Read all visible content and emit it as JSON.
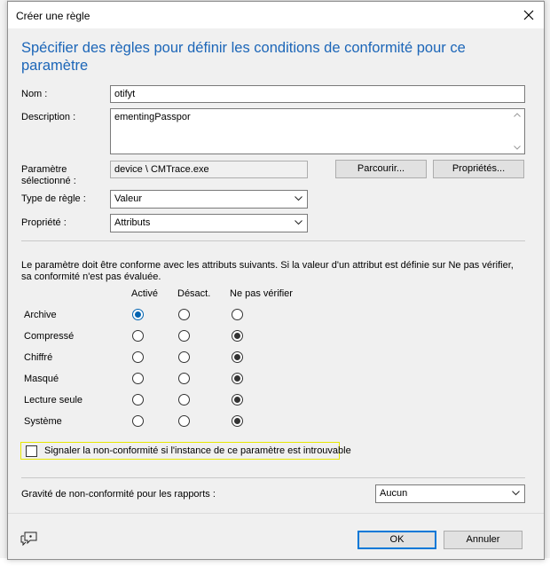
{
  "dialog": {
    "title": "Créer une règle",
    "heading": "Spécifier des règles pour définir les conditions de conformité pour ce paramètre"
  },
  "form": {
    "name_label": "Nom :",
    "name_value": "otifyt",
    "description_label": "Description :",
    "description_value": "ementingPasspor",
    "selected_setting_label_line1": "Paramètre",
    "selected_setting_label_line2": "sélectionné :",
    "selected_setting_value": "device \\ CMTrace.exe",
    "browse_button": "Parcourir...",
    "properties_button": "Propriétés...",
    "rule_type_label": "Type de règle :",
    "rule_type_value": "Valeur",
    "property_label": "Propriété :",
    "property_value": "Attributs"
  },
  "attributes": {
    "description": "Le paramètre doit être conforme avec les attributs suivants. Si la valeur d'un attribut est définie sur Ne pas vérifier, sa conformité n'est pas évaluée.",
    "columns": [
      "Activé",
      "Désact.",
      "Ne pas vérifier"
    ],
    "rows": [
      {
        "label": "Archive",
        "selected": 0
      },
      {
        "label": "Compressé",
        "selected": 2
      },
      {
        "label": "Chiffré",
        "selected": 2
      },
      {
        "label": "Masqué",
        "selected": 2
      },
      {
        "label": "Lecture seule",
        "selected": 2
      },
      {
        "label": "Système",
        "selected": 2
      }
    ]
  },
  "noncompliance": {
    "checkbox_label": "Signaler la non-conformité si l'instance de ce paramètre est introuvable",
    "checked": false,
    "severity_label": "Gravité de non-conformité pour les rapports :",
    "severity_value": "Aucun"
  },
  "footer": {
    "ok_button": "OK",
    "cancel_button": "Annuler"
  },
  "colors": {
    "heading": "#1c66b8",
    "default_button_border": "#0078d7",
    "checkbox_highlight": "#e6e600"
  }
}
